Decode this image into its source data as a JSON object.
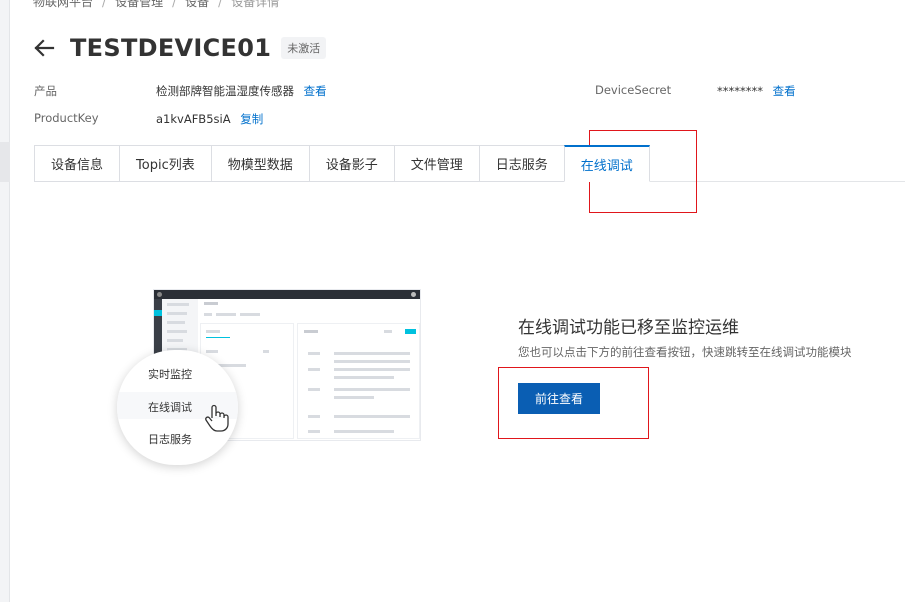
{
  "breadcrumb": {
    "items": [
      "物联网平台",
      "设备管理",
      "设备"
    ],
    "current": "设备详情"
  },
  "header": {
    "device_name": "TESTDEVICE01",
    "status": "未激活"
  },
  "meta": {
    "product_label": "产品",
    "product_value": "检测部牌智能温湿度传感器",
    "product_link": "查看",
    "productkey_label": "ProductKey",
    "productkey_value": "a1kvAFB5siA",
    "productkey_link": "复制",
    "secret_label": "DeviceSecret",
    "secret_value": "********",
    "secret_link": "查看"
  },
  "tabs": [
    {
      "label": "设备信息"
    },
    {
      "label": "Topic列表"
    },
    {
      "label": "物模型数据"
    },
    {
      "label": "设备影子"
    },
    {
      "label": "文件管理"
    },
    {
      "label": "日志服务"
    },
    {
      "label": "在线调试",
      "active": true
    }
  ],
  "illustration": {
    "menu_items": [
      "实时监控",
      "在线调试",
      "日志服务"
    ],
    "cursor_icon": "hand-pointer-icon"
  },
  "notice": {
    "title": "在线调试功能已移至监控运维",
    "subtitle": "您也可以点击下方的前往查看按钮，快速跳转至在线调试功能模块",
    "button_label": "前往查看"
  },
  "colors": {
    "link": "#0070cc",
    "primary_button": "#0a5eb3",
    "highlight_box": "#e0161b",
    "accent_cyan": "#00c1de"
  }
}
